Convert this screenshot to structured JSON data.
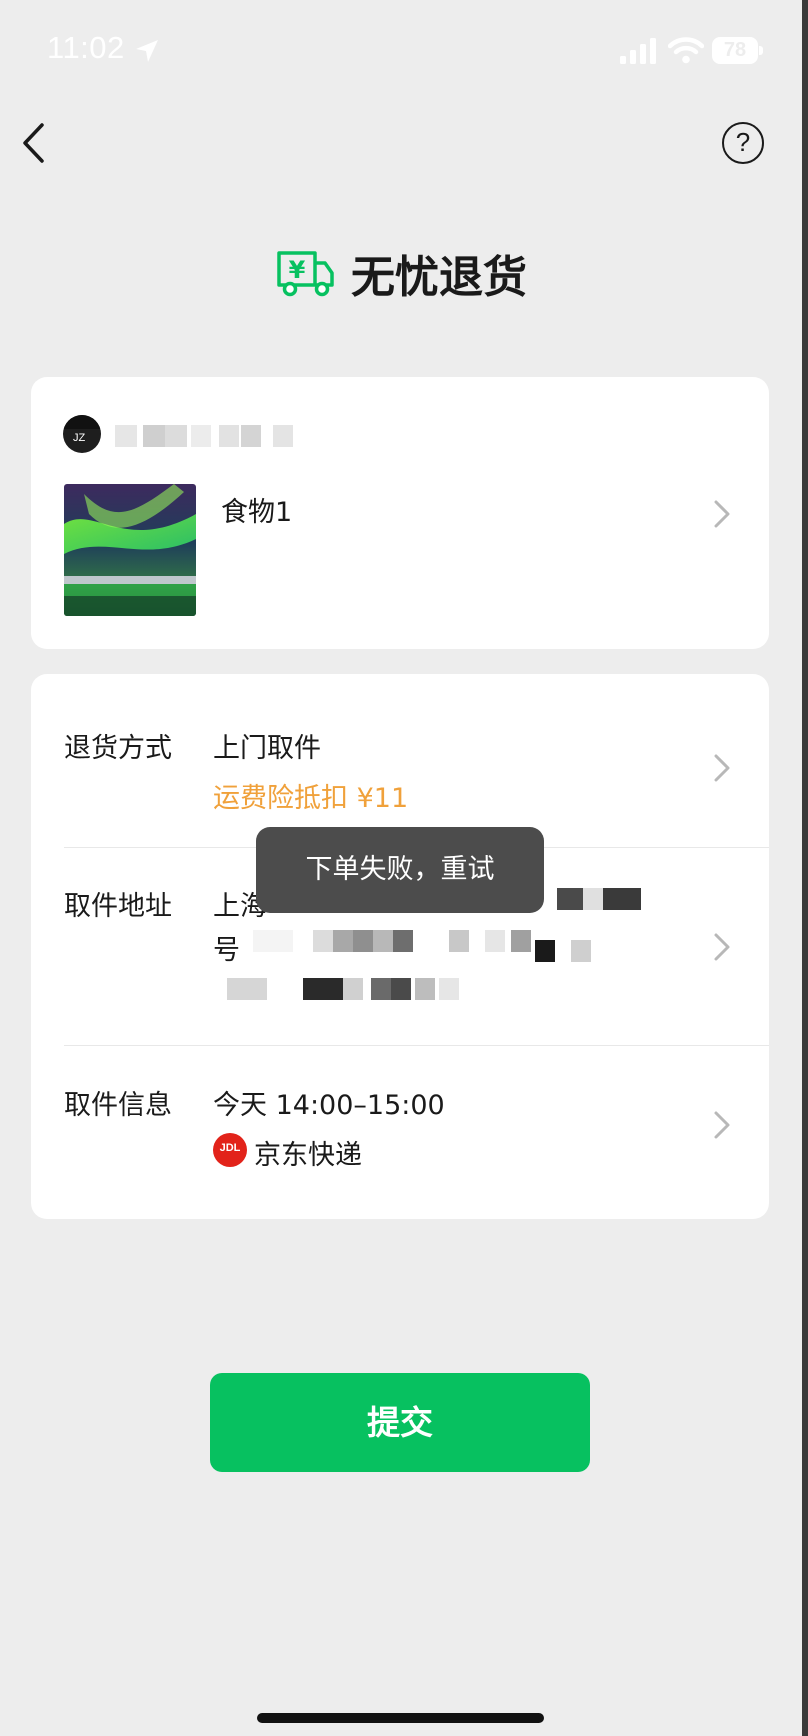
{
  "status_bar": {
    "time": "11:02",
    "battery": "78"
  },
  "header": {
    "title": "无忧退货"
  },
  "product": {
    "name": "食物1"
  },
  "return_method": {
    "label": "退货方式",
    "value": "上门取件",
    "note": "运费险抵扣 ¥11"
  },
  "pickup_address": {
    "label": "取件地址",
    "line1": "上海",
    "line2": "号"
  },
  "pickup_info": {
    "label": "取件信息",
    "time": "今天 14:00–15:00",
    "courier": "京东快递",
    "courier_logo": "JDL"
  },
  "toast": {
    "message": "下单失败，重试"
  },
  "submit": {
    "label": "提交"
  },
  "colors": {
    "accent": "#07c160",
    "warning": "#f0a13b",
    "toast_bg": "#4c4c4c",
    "courier_red": "#e2231a"
  }
}
